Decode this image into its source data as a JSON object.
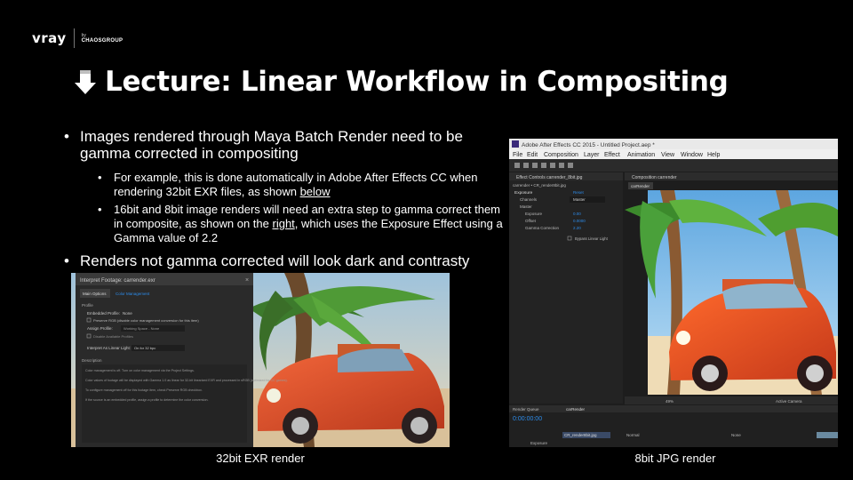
{
  "logo": {
    "brand": "vray",
    "by": "by",
    "group": "CHAOSGROUP"
  },
  "title": "Lecture: Linear Workflow in Compositing",
  "bullets": {
    "b1": "Images rendered through Maya Batch Render need to be gamma corrected in compositing",
    "sub1_pre": "For example, this is done automatically in Adobe After Effects CC when rendering 32bit EXR files, as shown ",
    "sub1_link": "below",
    "sub2_pre": "16bit and 8bit image renders will need an extra step to gamma correct them in composite, as shown on the ",
    "sub2_link": "right",
    "sub2_post": ", which uses the Exposure Effect using a Gamma value of 2.2",
    "b2": "Renders not gamma corrected will look dark and contrasty"
  },
  "left_dialog": {
    "title": "Interpret Footage: carrender.exr",
    "tabs": [
      "Main Options",
      "Color Management"
    ],
    "section_profile": "Profile",
    "embedded_profile_label": "Embedded Profile:",
    "embedded_profile_value": "None",
    "assign_profile_label": "Assign Profile:",
    "assign_profile_value": "Working Space - None",
    "checkbox_label": "Preserve RGB (disable color management conversion for this item)",
    "checkbox_label2": "Disable Available Profiles",
    "interpret_label": "Interpret As Linear Light:",
    "interpret_value": "On for 32 bpc",
    "description_title": "Description",
    "desc_lines": [
      "Color management is off. Turn on color management via the Project Settings.",
      "Color values of footage will be displayed with Gamma 1.0 as linear for 32-bit linearized EXR and processed in sRGB (optimized for CC games).",
      "To configure management off for this footage item, check Preserve RGB checkbox.",
      "If the source is an embedded profile, assign a profile to determine the color conversion."
    ]
  },
  "ae_window": {
    "title": "Adobe After Effects CC 2015 - Untitled Project.aep *",
    "menu": [
      "File",
      "Edit",
      "Composition",
      "Layer",
      "Effect",
      "Animation",
      "View",
      "Window",
      "Help"
    ],
    "panel_tab": "Effect Controls carrender_8bit.jpg",
    "comp_tab": "Composition carrender",
    "layer_name": "carrender • CR_render8bit.jpg",
    "effect_name": "Exposure",
    "effect_link": "Reset",
    "channels_label": "Channels",
    "channels_value": "Master",
    "master_label": "Master",
    "exposure_label": "Exposure",
    "exposure_value": "0.00",
    "offset_label": "Offset",
    "offset_value": "0.0000",
    "gamma_label": "Gamma Correction",
    "gamma_value": "2.20",
    "bypass_label": "Bypass Linear Light",
    "zoom": "49%",
    "camera": "Active Camera",
    "timeline_tab": "carRender",
    "render_queue": "Render Queue",
    "timecode": "0:00:00:00",
    "layer_row": "CR_render8bit.jpg",
    "mode": "Normal",
    "parent": "None",
    "fx_row": "Exposure"
  },
  "captions": {
    "left": "32bit EXR render",
    "right": "8bit JPG render"
  },
  "colors": {
    "background": "#000000",
    "text": "#ffffff",
    "ae_panel": "#232323",
    "ae_blue": "#2d8ceb"
  }
}
